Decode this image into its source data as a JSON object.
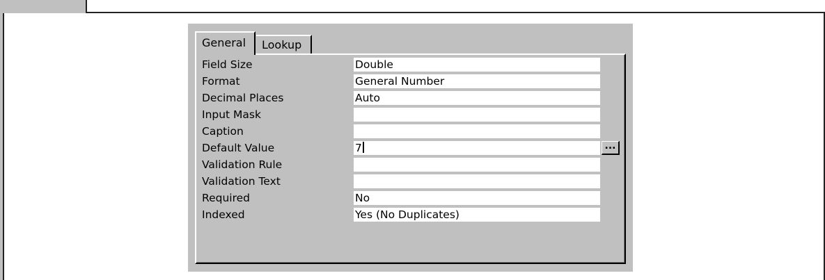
{
  "tabs": [
    {
      "label": "General"
    },
    {
      "label": "Lookup"
    }
  ],
  "properties": [
    {
      "label": "Field Size",
      "value": "Double"
    },
    {
      "label": "Format",
      "value": "General Number"
    },
    {
      "label": "Decimal Places",
      "value": "Auto"
    },
    {
      "label": "Input Mask",
      "value": ""
    },
    {
      "label": "Caption",
      "value": ""
    },
    {
      "label": "Default Value",
      "value": "7"
    },
    {
      "label": "Validation Rule",
      "value": ""
    },
    {
      "label": "Validation Text",
      "value": ""
    },
    {
      "label": "Required",
      "value": "No"
    },
    {
      "label": "Indexed",
      "value": "Yes (No Duplicates)"
    }
  ],
  "builder_button": {
    "label": "..."
  },
  "colors": {
    "dialog": "#c0c0c0",
    "field": "#ffffff",
    "text": "#000000"
  }
}
